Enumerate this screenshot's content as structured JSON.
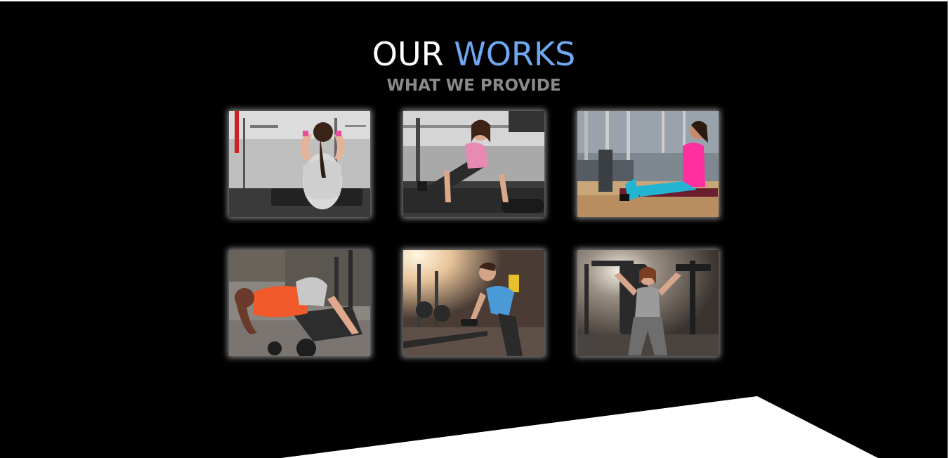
{
  "section": {
    "title_part1": "OUR",
    "title_part2": "WORKS",
    "subtitle": "WHAT WE PROVIDE"
  },
  "colors": {
    "background": "#000000",
    "title": "#ffffff",
    "accent": "#6fa8f0",
    "subtitle": "#8a8a8a"
  },
  "gallery": {
    "images": [
      {
        "name": "gallery-image-1"
      },
      {
        "name": "gallery-image-2"
      },
      {
        "name": "gallery-image-3"
      },
      {
        "name": "gallery-image-4"
      },
      {
        "name": "gallery-image-5"
      },
      {
        "name": "gallery-image-6"
      }
    ]
  }
}
